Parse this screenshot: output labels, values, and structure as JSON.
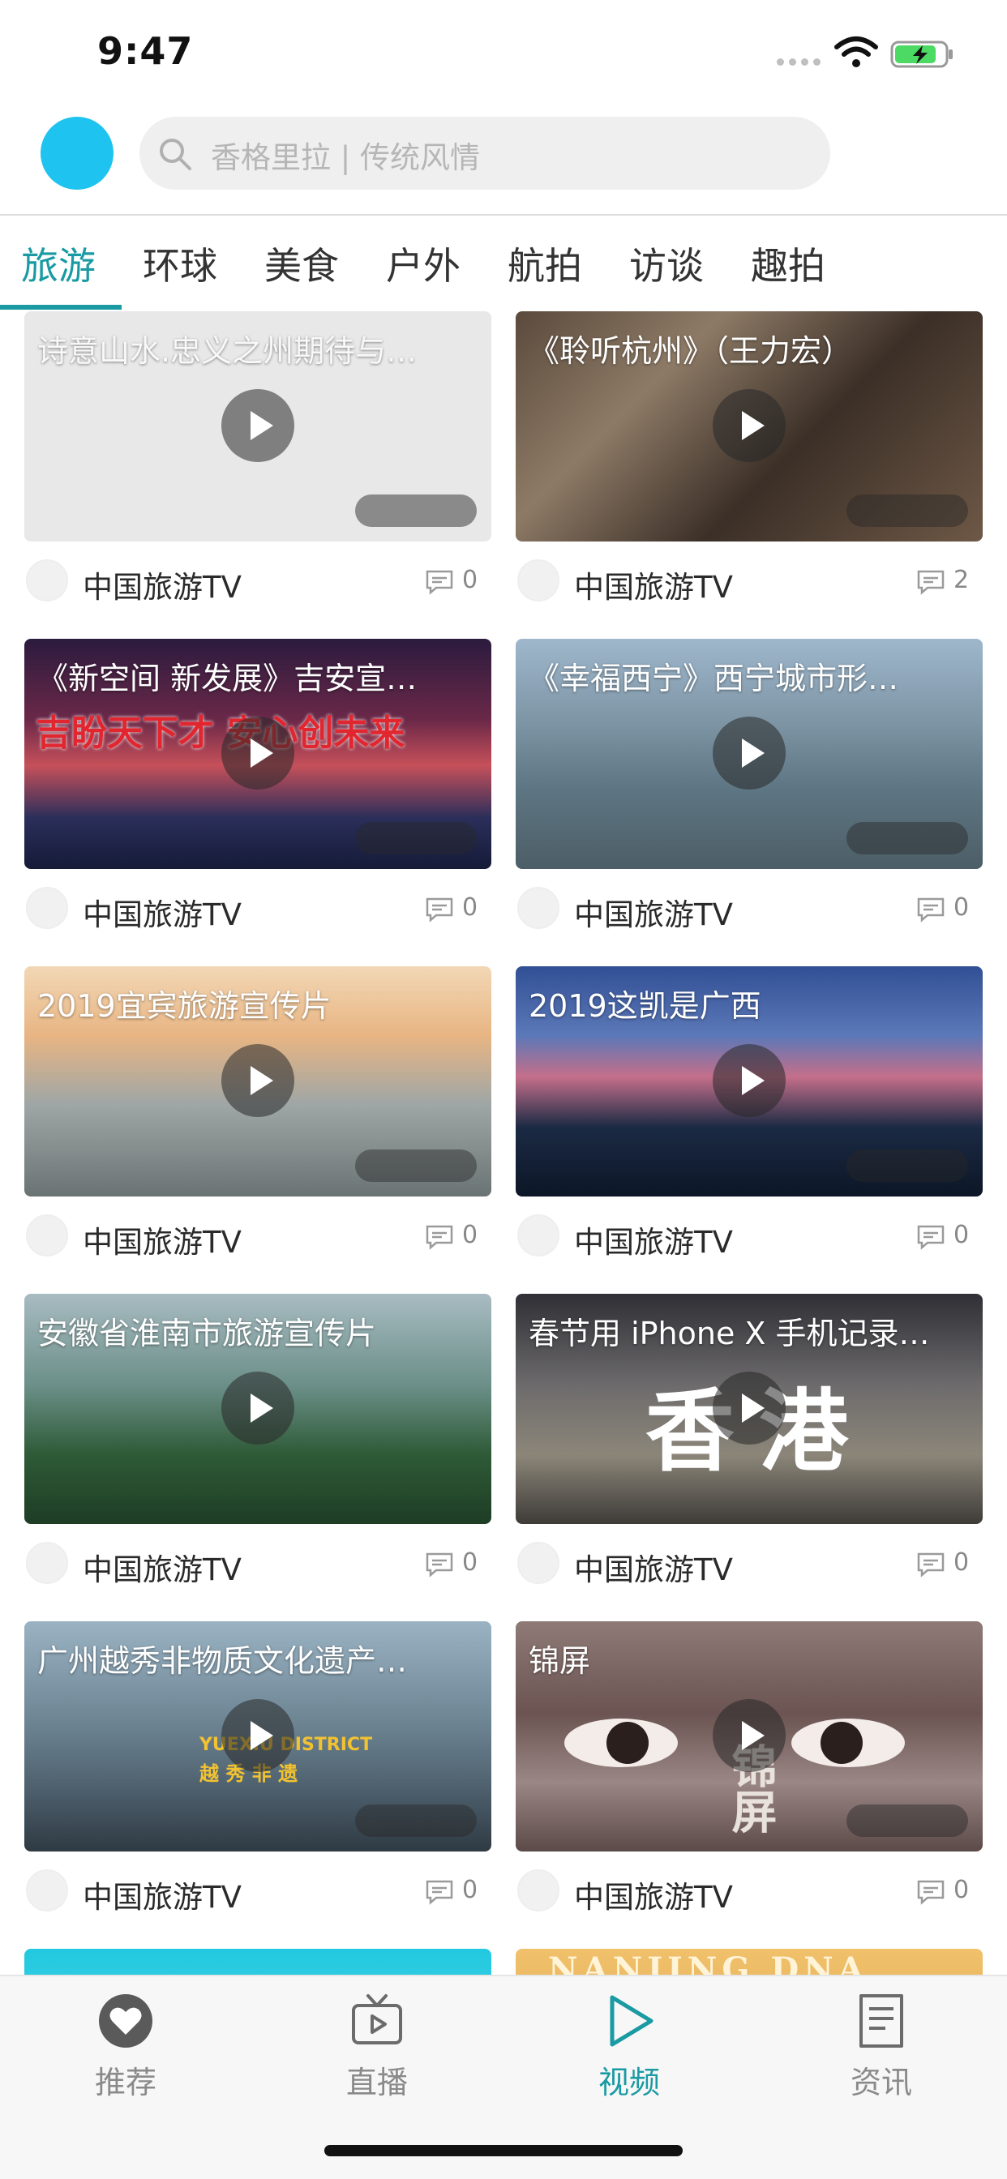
{
  "status_bar": {
    "time": "9:47"
  },
  "header": {
    "search_placeholder": "香格里拉 | 传统风情"
  },
  "tabs": [
    "旅游",
    "环球",
    "美食",
    "户外",
    "航拍",
    "访谈",
    "趣拍"
  ],
  "active_tab": "旅游",
  "videos": [
    {
      "title": "诗意山水.忠义之州期待与…",
      "channel": "中国旅游TV",
      "comments": "0"
    },
    {
      "title": "《聆听杭州》（王力宏）",
      "channel": "中国旅游TV",
      "comments": "2"
    },
    {
      "title": "《新空间 新发展》吉安宣…",
      "channel": "中国旅游TV",
      "comments": "0"
    },
    {
      "title": "《幸福西宁》西宁城市形…",
      "channel": "中国旅游TV",
      "comments": "0"
    },
    {
      "title": "2019宜宾旅游宣传片",
      "channel": "中国旅游TV",
      "comments": "0"
    },
    {
      "title": "2019这凯是广西",
      "channel": "中国旅游TV",
      "comments": "0"
    },
    {
      "title": "安徽省淮南市旅游宣传片",
      "channel": "中国旅游TV",
      "comments": "0"
    },
    {
      "title": "春节用 iPhone X 手机记录…",
      "channel": "中国旅游TV",
      "comments": "0"
    },
    {
      "title": "广州越秀非物质文化遗产…",
      "channel": "中国旅游TV",
      "comments": "0"
    },
    {
      "title": "锦屏",
      "channel": "中国旅游TV",
      "comments": "0"
    }
  ],
  "thumbnail_overlays": {
    "jian_banner": "吉盼天下才 安心创未来",
    "hongkong": "香港",
    "yuexiu_en": "YUEXIU DISTRICT",
    "yuexiu_cn": "越 秀 非 遗",
    "jinping": "锦屏",
    "nanjing": "NANJING DNA"
  },
  "tabbar": {
    "items": [
      {
        "label": "推荐",
        "icon": "heart-icon"
      },
      {
        "label": "直播",
        "icon": "tv-icon"
      },
      {
        "label": "视频",
        "icon": "play-icon"
      },
      {
        "label": "资讯",
        "icon": "news-icon"
      }
    ],
    "active": "视频"
  },
  "colors": {
    "accent": "#1a9aa3",
    "avatar": "#1ec3f0"
  }
}
